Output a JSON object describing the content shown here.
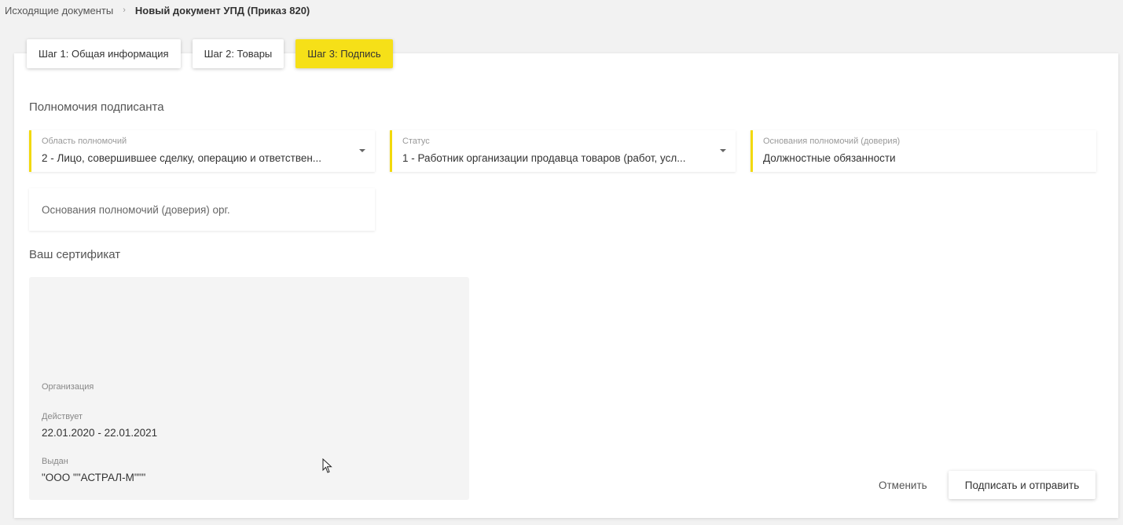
{
  "breadcrumb": {
    "parent": "Исходящие документы",
    "separator": "›",
    "current": "Новый документ УПД (Приказ 820)"
  },
  "tabs": [
    {
      "label": "Шаг 1: Общая информация",
      "active": false
    },
    {
      "label": "Шаг 2: Товары",
      "active": false
    },
    {
      "label": "Шаг 3: Подпись",
      "active": true
    }
  ],
  "signer": {
    "section_title": "Полномочия подписанта",
    "scope": {
      "label": "Область полномочий",
      "value": "2 - Лицо, совершившее сделку, операцию и ответствен..."
    },
    "status": {
      "label": "Статус",
      "value": "1 - Работник организации продавца товаров (работ, усл..."
    },
    "basis": {
      "label": "Основания полномочий (доверия)",
      "value": "Должностные обязанности"
    },
    "basis_org": {
      "placeholder": "Основания полномочий (доверия) орг."
    }
  },
  "certificate": {
    "section_title": "Ваш сертификат",
    "org_label": "Организация",
    "valid_label": "Действует",
    "valid_value": "22.01.2020 - 22.01.2021",
    "issuer_label": "Выдан",
    "issuer_value": "\"ООО \"\"АСТРАЛ-М\"\"\""
  },
  "actions": {
    "cancel": "Отменить",
    "sign_send": "Подписать и отправить"
  },
  "colors": {
    "accent_yellow": "#f6e018",
    "field_accent": "#f2d90c"
  }
}
